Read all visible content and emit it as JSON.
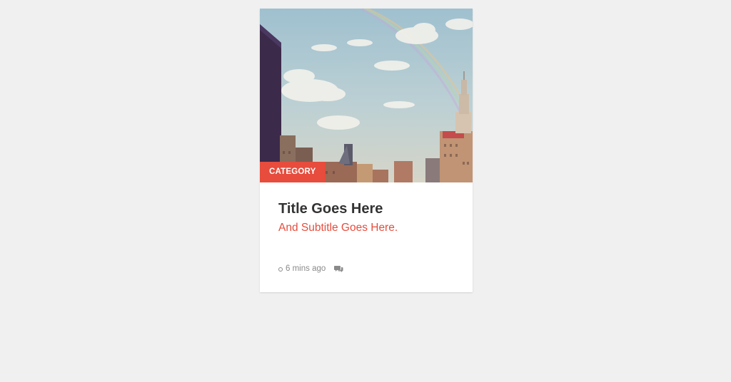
{
  "card": {
    "category_label": "CATEGORY",
    "title": "Title Goes Here",
    "subtitle": "And Subtitle Goes Here.",
    "time_ago": "6 mins ago",
    "image": {
      "alt": "city skyline with rainbow"
    },
    "colors": {
      "accent": "#e74c3c",
      "title": "#333333",
      "meta": "#8a8a8a",
      "background": "#f0f0f0",
      "card": "#ffffff"
    },
    "icons": {
      "time": "clock-icon",
      "comments": "comments-icon"
    }
  }
}
